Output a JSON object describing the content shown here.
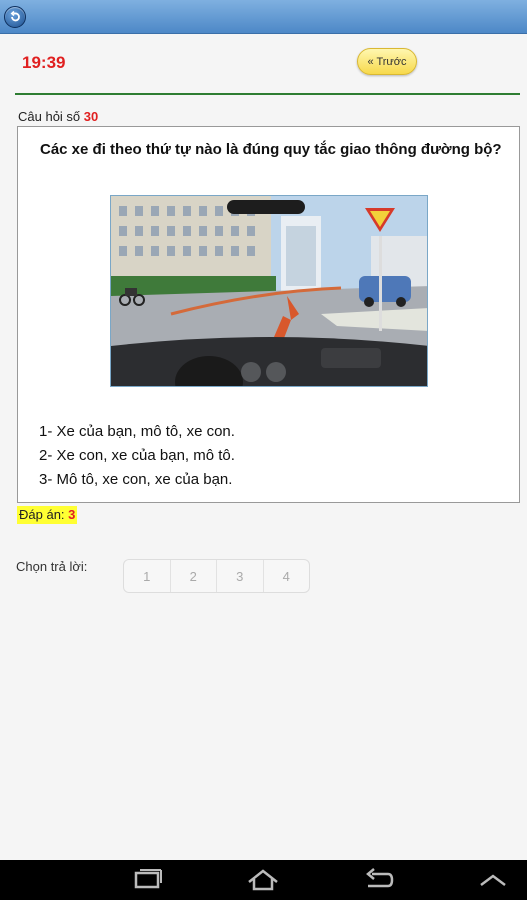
{
  "header": {
    "timer": "19:39",
    "prev_label": "« Trước"
  },
  "question": {
    "number_label": "Câu hỏi số",
    "number": "30",
    "text": "Các xe đi theo thứ tự nào là đúng quy tắc giao thông đường bộ?",
    "options": [
      "1- Xe của bạn, mô tô, xe con.",
      "2- Xe con, xe của bạn, mô tô.",
      "3- Mô tô, xe con, xe của bạn."
    ]
  },
  "answer": {
    "label": "Đáp án:",
    "value": "3"
  },
  "choose": {
    "label": "Chọn trả lời:",
    "choices": [
      "1",
      "2",
      "3",
      "4"
    ]
  },
  "icons": {
    "back": "back-circle-icon",
    "nav": [
      "recent-apps-icon",
      "home-icon",
      "back-arrow-icon",
      "chevron-up-icon"
    ]
  },
  "colors": {
    "timer": "#e02020",
    "accent_line": "#2e7d32",
    "highlight": "#ffff33"
  }
}
